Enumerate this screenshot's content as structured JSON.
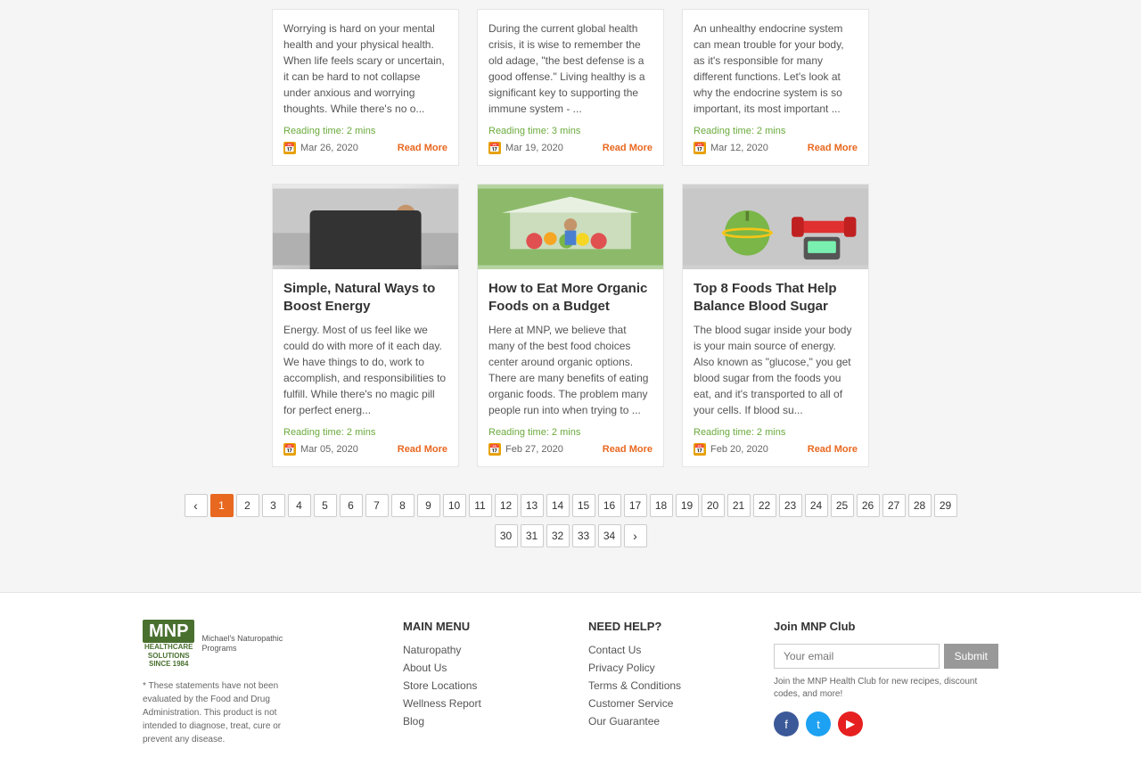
{
  "topCards": [
    {
      "text": "Worrying is hard on your mental health and your physical health. When life feels scary or uncertain, it can be hard to not collapse under anxious and worrying thoughts. While there's no o...",
      "readingTime": "Reading time: 2 mins",
      "date": "Mar 26, 2020",
      "readMore": "Read More"
    },
    {
      "text": "During the current global health crisis, it is wise to remember the old adage, \"the best defense is a good offense.\" Living healthy is a significant key to supporting the immune system - ...",
      "readingTime": "Reading time: 3 mins",
      "date": "Mar 19, 2020",
      "readMore": "Read More"
    },
    {
      "text": "An unhealthy endocrine system can mean trouble for your body, as it's responsible for many different functions. Let's look at why the endocrine system is so important, its most important ...",
      "readingTime": "Reading time: 2 mins",
      "date": "Mar 12, 2020",
      "readMore": "Read More"
    }
  ],
  "bottomCards": [
    {
      "title": "Simple, Natural Ways to Boost Energy",
      "text": "Energy. Most of us feel like we could do with more of it each day. We have things to do, work to accomplish, and responsibilities to fulfill. While there's no magic pill for perfect energ...",
      "readingTime": "Reading time: 2 mins",
      "date": "Mar 05, 2020",
      "readMore": "Read More",
      "imgType": "energy"
    },
    {
      "title": "How to Eat More Organic Foods on a Budget",
      "text": "Here at MNP, we believe that many of the best food choices center around organic options. There are many benefits of eating organic foods. The problem many people run into when trying to ...",
      "readingTime": "Reading time: 2 mins",
      "date": "Feb 27, 2020",
      "readMore": "Read More",
      "imgType": "organic"
    },
    {
      "title": "Top 8 Foods That Help Balance Blood Sugar",
      "text": "The blood sugar inside your body is your main source of energy. Also known as \"glucose,\" you get blood sugar from the foods you eat, and it's transported to all of your cells. If blood su...",
      "readingTime": "Reading time: 2 mins",
      "date": "Feb 20, 2020",
      "readMore": "Read More",
      "imgType": "bloodsugar"
    }
  ],
  "pagination": {
    "pages": [
      1,
      2,
      3,
      4,
      5,
      6,
      7,
      8,
      9,
      10,
      11,
      12,
      13,
      14,
      15,
      16,
      17,
      18,
      19,
      20,
      21,
      22,
      23,
      24,
      25,
      26,
      27,
      28,
      29
    ],
    "pages2": [
      30,
      31,
      32,
      33,
      34
    ],
    "activePage": 1
  },
  "footer": {
    "logoText": "MNP",
    "logoSubtitle": "HEALTHCARE\nSOLUTIONS\nSINCE 1984",
    "logoSmall": "Michael's Naturopathic Programs",
    "disclaimer": "* These statements have not been evaluated by the Food and Drug Administration. This product is not intended to diagnose, treat, cure or prevent any disease.",
    "mainMenu": {
      "title": "MAIN MENU",
      "links": [
        "Naturopathy",
        "About Us",
        "Store Locations",
        "Wellness Report",
        "Blog"
      ]
    },
    "needHelp": {
      "title": "NEED HELP?",
      "links": [
        "Contact Us",
        "Privacy Policy",
        "Terms & Conditions",
        "Customer Service",
        "Our Guarantee"
      ]
    },
    "joinClub": {
      "title": "Join MNP Club",
      "emailPlaceholder": "Your email",
      "submitLabel": "Submit",
      "joinText": "Join the MNP Health Club for new recipes, discount codes, and more!"
    }
  }
}
